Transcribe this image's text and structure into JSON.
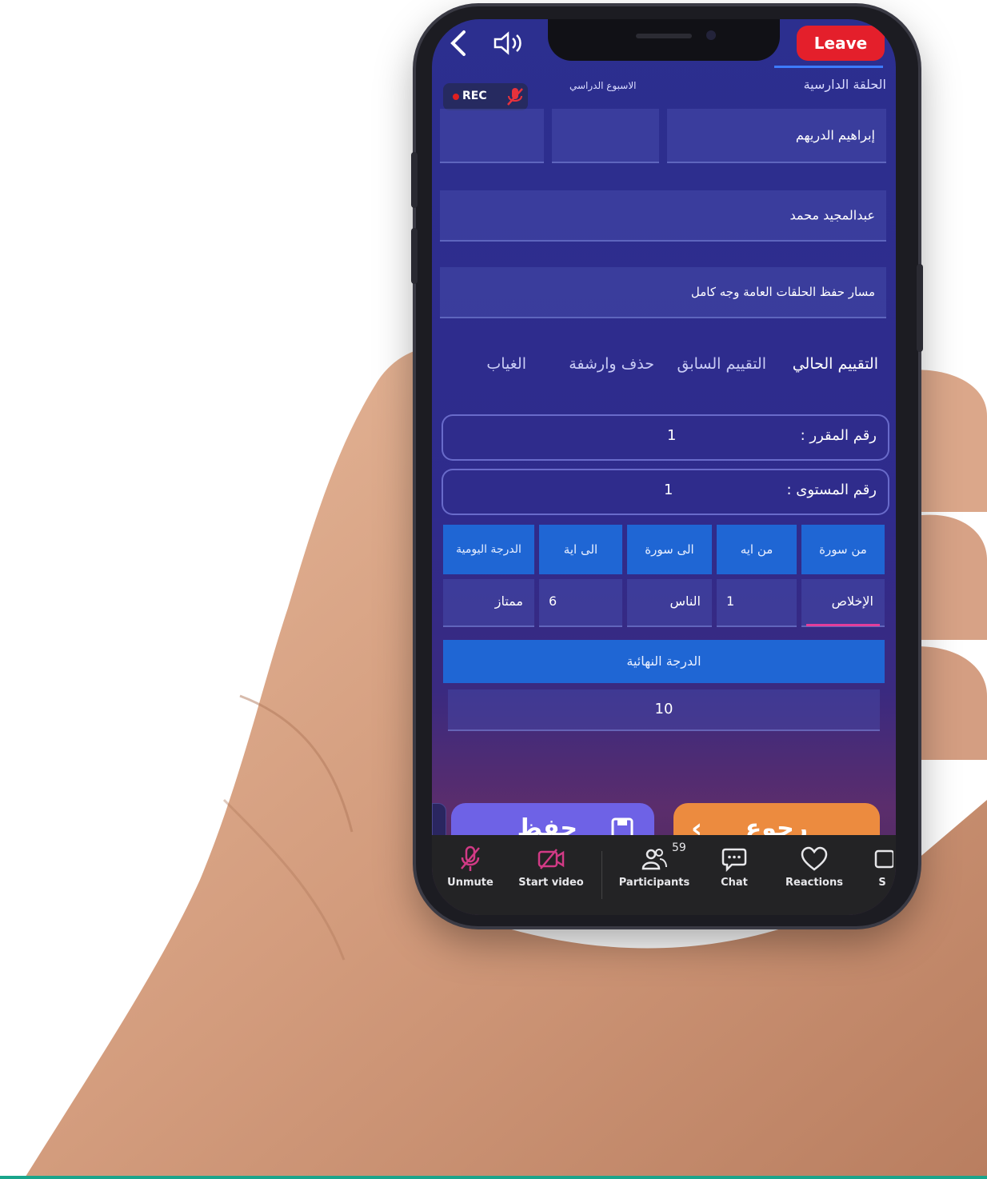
{
  "app": {
    "leave_label": "Leave",
    "rec_label": "REC"
  },
  "header": {
    "circle_label": "الحلقة الدارسية",
    "week_label": "الاسبوع الدراسي"
  },
  "fields": {
    "teacher_name": "إبراهيم الدريهم",
    "student_name": "عبدالمجيد محمد",
    "track_name": "مسار حفظ الحلقات العامة وجه كامل"
  },
  "tabs": [
    {
      "label": "التقييم الحالي",
      "active": true
    },
    {
      "label": "التقييم السابق",
      "active": false
    },
    {
      "label": "حذف وارشفة",
      "active": false
    },
    {
      "label": "الغياب",
      "active": false
    }
  ],
  "course": {
    "label": "رقم المقرر :",
    "value": "1"
  },
  "level": {
    "label": "رقم المستوى :",
    "value": "1"
  },
  "grid": {
    "headers": [
      "من سورة",
      "من ايه",
      "الى سورة",
      "الى اية",
      "الدرجة اليومية"
    ],
    "from_surah": "الإخلاص",
    "from_ayah": "1",
    "to_surah": "الناس",
    "to_ayah": "6",
    "daily_grade": "ممتاز"
  },
  "final": {
    "label": "الدرجة النهائية",
    "value": "10"
  },
  "buttons": {
    "save_label": "حفظ",
    "back_label": "رجوع"
  },
  "toolbar": {
    "unmute": "Unmute",
    "start_video": "Start video",
    "participants": "Participants",
    "participants_count": "59",
    "chat": "Chat",
    "reactions": "Reactions",
    "share_partial": "S"
  },
  "colors": {
    "leave": "#e41f2b",
    "tab_active_underline": "#3d7bff",
    "grid_header": "#1f66d4",
    "save_button": "#6e62e6",
    "back_button": "#ec8b3f",
    "accent_pink": "#e33e9b"
  }
}
